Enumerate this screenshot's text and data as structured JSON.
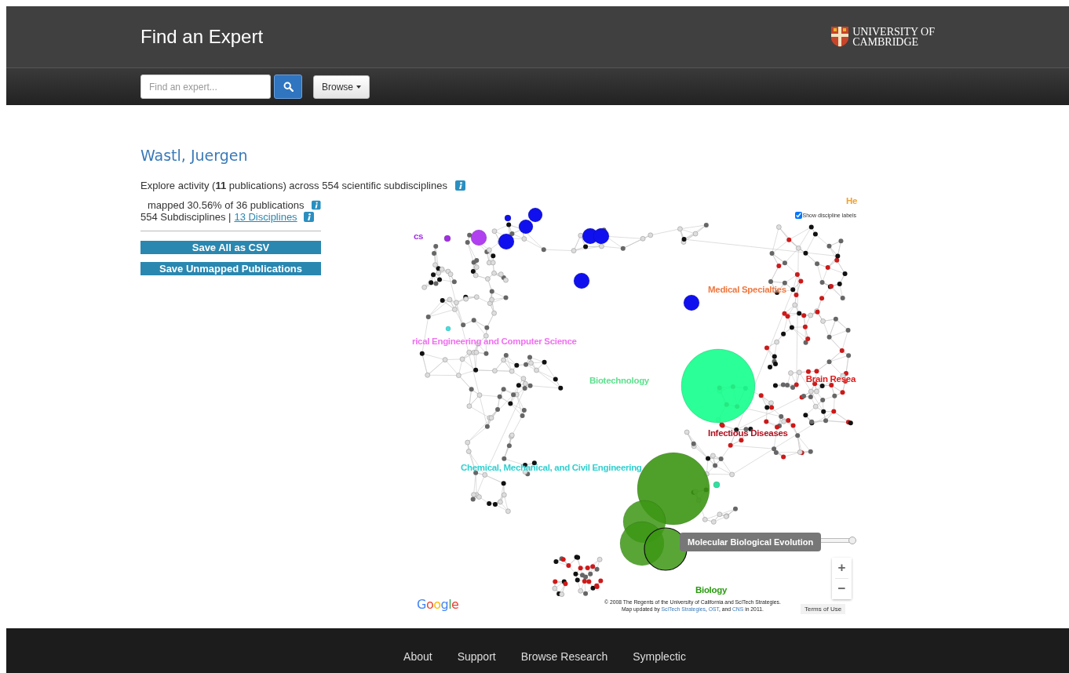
{
  "header": {
    "title": "Find an Expert",
    "logo_lines": [
      "UNIVERSITY OF",
      "CAMBRIDGE"
    ]
  },
  "nav": {
    "search": {
      "placeholder": "Find an expert..."
    },
    "browse": "Browse"
  },
  "profile": {
    "name": "Wastl, Juergen",
    "summary": "Explore activity (**11** publications) across 554 scientific subdisciplines",
    "mapped": "mapped 30.56% of 36 publications",
    "subdisciplines": "554 Subdisciplines |",
    "disciplines_link": "13 Disciplines",
    "buttons": [
      "Save All as CSV",
      "Save Unmapped Publications"
    ]
  },
  "map": {
    "show_labels": {
      "label": "Show discipline labels",
      "checked": true
    },
    "discipline_labels": [
      {
        "text": "He",
        "color": "#f0a030"
      },
      {
        "text": "cs",
        "color": "#a030e0"
      },
      {
        "text": "Medical Specialties",
        "color": "#f07840"
      },
      {
        "text": "rical Engineering and Computer Science",
        "color": "#f070f0"
      },
      {
        "text": "Biotechnology",
        "color": "#60e090"
      },
      {
        "text": "Brain Resea",
        "color": "#e01818"
      },
      {
        "text": "Infectious Diseases",
        "color": "#b01020"
      },
      {
        "text": "Chemical, Mechanical, and Civil Engineering",
        "color": "#30d0d0"
      },
      {
        "text": "Biology",
        "color": "#2a9a10"
      }
    ],
    "tooltip": "Molecular Biological Evolution",
    "slider": {
      "level": 1
    },
    "zoom": [
      "+",
      "−"
    ],
    "logo": "Google",
    "credit_line": "© 2008 The Regents of the University of California and SciTech Strategies.",
    "credit_parts": [
      {
        "text": "Map updated by ",
        "kind": "text"
      },
      {
        "text": "SciTech Strategies",
        "kind": "link"
      },
      {
        "text": ", ",
        "kind": "text"
      },
      {
        "text": "OST",
        "kind": "link"
      },
      {
        "text": ", and ",
        "kind": "text"
      },
      {
        "text": "CNS",
        "kind": "link"
      },
      {
        "text": " in 2011.",
        "kind": "text"
      }
    ],
    "terms": "Terms of Use"
  },
  "footer": {
    "links": [
      "About",
      "Support",
      "Browse Research",
      "Symplectic"
    ]
  }
}
